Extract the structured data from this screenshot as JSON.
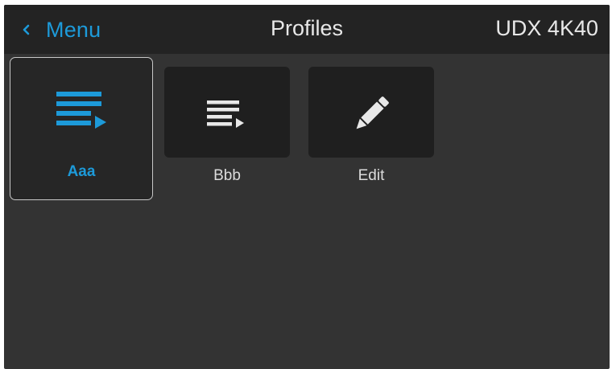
{
  "header": {
    "back_label": "Menu",
    "title": "Profiles",
    "device": "UDX 4K40"
  },
  "tiles": [
    {
      "label": "Aaa",
      "icon": "playlist-play-icon",
      "selected": true
    },
    {
      "label": "Bbb",
      "icon": "playlist-play-icon",
      "selected": false
    },
    {
      "label": "Edit",
      "icon": "pencil-icon",
      "selected": false
    }
  ],
  "colors": {
    "accent": "#1d9ad9",
    "background": "#333333",
    "header": "#232323",
    "tile": "#1f1f1f"
  }
}
